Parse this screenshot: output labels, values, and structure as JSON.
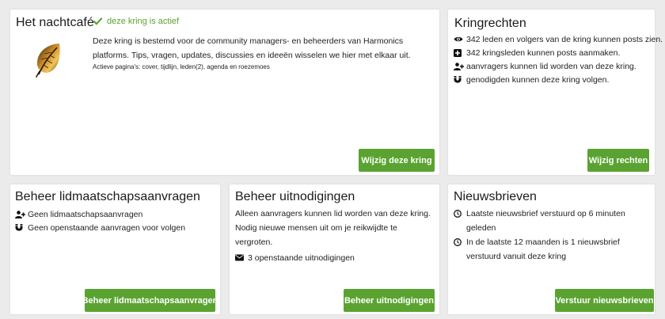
{
  "kring": {
    "title": "Het nachtcafé",
    "status": "deze kring is actief",
    "description": "Deze kring is bestemd voor de community managers- en beheerders van Harmonics platforms. Tips, vragen, updates, discussies en ideeën wisselen we hier met elkaar uit.",
    "active_pages": "Actieve pagina's: cover, tijdlijn, leden(2), agenda en roezemoes",
    "edit_button": "Wijzig deze kring",
    "icons": [
      "leaf-icon",
      "check-icon"
    ],
    "status_color": "#5aa331"
  },
  "rights": {
    "title": "Kringrechten",
    "items": [
      {
        "icon": "eye-icon",
        "text": "342 leden en volgers van de kring kunnen posts zien."
      },
      {
        "icon": "plus-square-icon",
        "text": "342 kringsleden kunnen posts aanmaken."
      },
      {
        "icon": "user-plus-icon",
        "text": "aanvragers kunnen lid worden van deze kring."
      },
      {
        "icon": "magnet-icon",
        "text": "genodigden kunnen deze kring volgen."
      }
    ],
    "button": "Wijzig rechten"
  },
  "membership": {
    "title": "Beheer lidmaatschapsaanvragen",
    "items": [
      {
        "icon": "user-plus-icon",
        "text": "Geen lidmaatschapsaanvragen"
      },
      {
        "icon": "magnet-icon",
        "text": "Geen openstaande aanvragen voor volgen"
      }
    ],
    "button": "Beheer lidmaatschapsaanvragen"
  },
  "invitations": {
    "title": "Beheer uitnodigingen",
    "description": "Alleen aanvragers kunnen lid worden van deze kring. Nodig nieuwe mensen uit om je reikwijdte te vergroten.",
    "items": [
      {
        "icon": "envelope-icon",
        "text": "3 openstaande uitnodigingen"
      }
    ],
    "button": "Beheer uitnodigingen"
  },
  "newsletters": {
    "title": "Nieuwsbrieven",
    "items": [
      {
        "icon": "clock-icon",
        "text": "Laatste nieuwsbrief verstuurd op 6 minuten geleden"
      },
      {
        "icon": "clock-icon",
        "text": "In de laatste 12 maanden is 1 nieuwsbrief verstuurd vanuit deze kring"
      }
    ],
    "button": "Verstuur nieuwsbrieven"
  },
  "colors": {
    "button": "#5aa331",
    "background": "#ebebeb",
    "card": "#ffffff"
  }
}
